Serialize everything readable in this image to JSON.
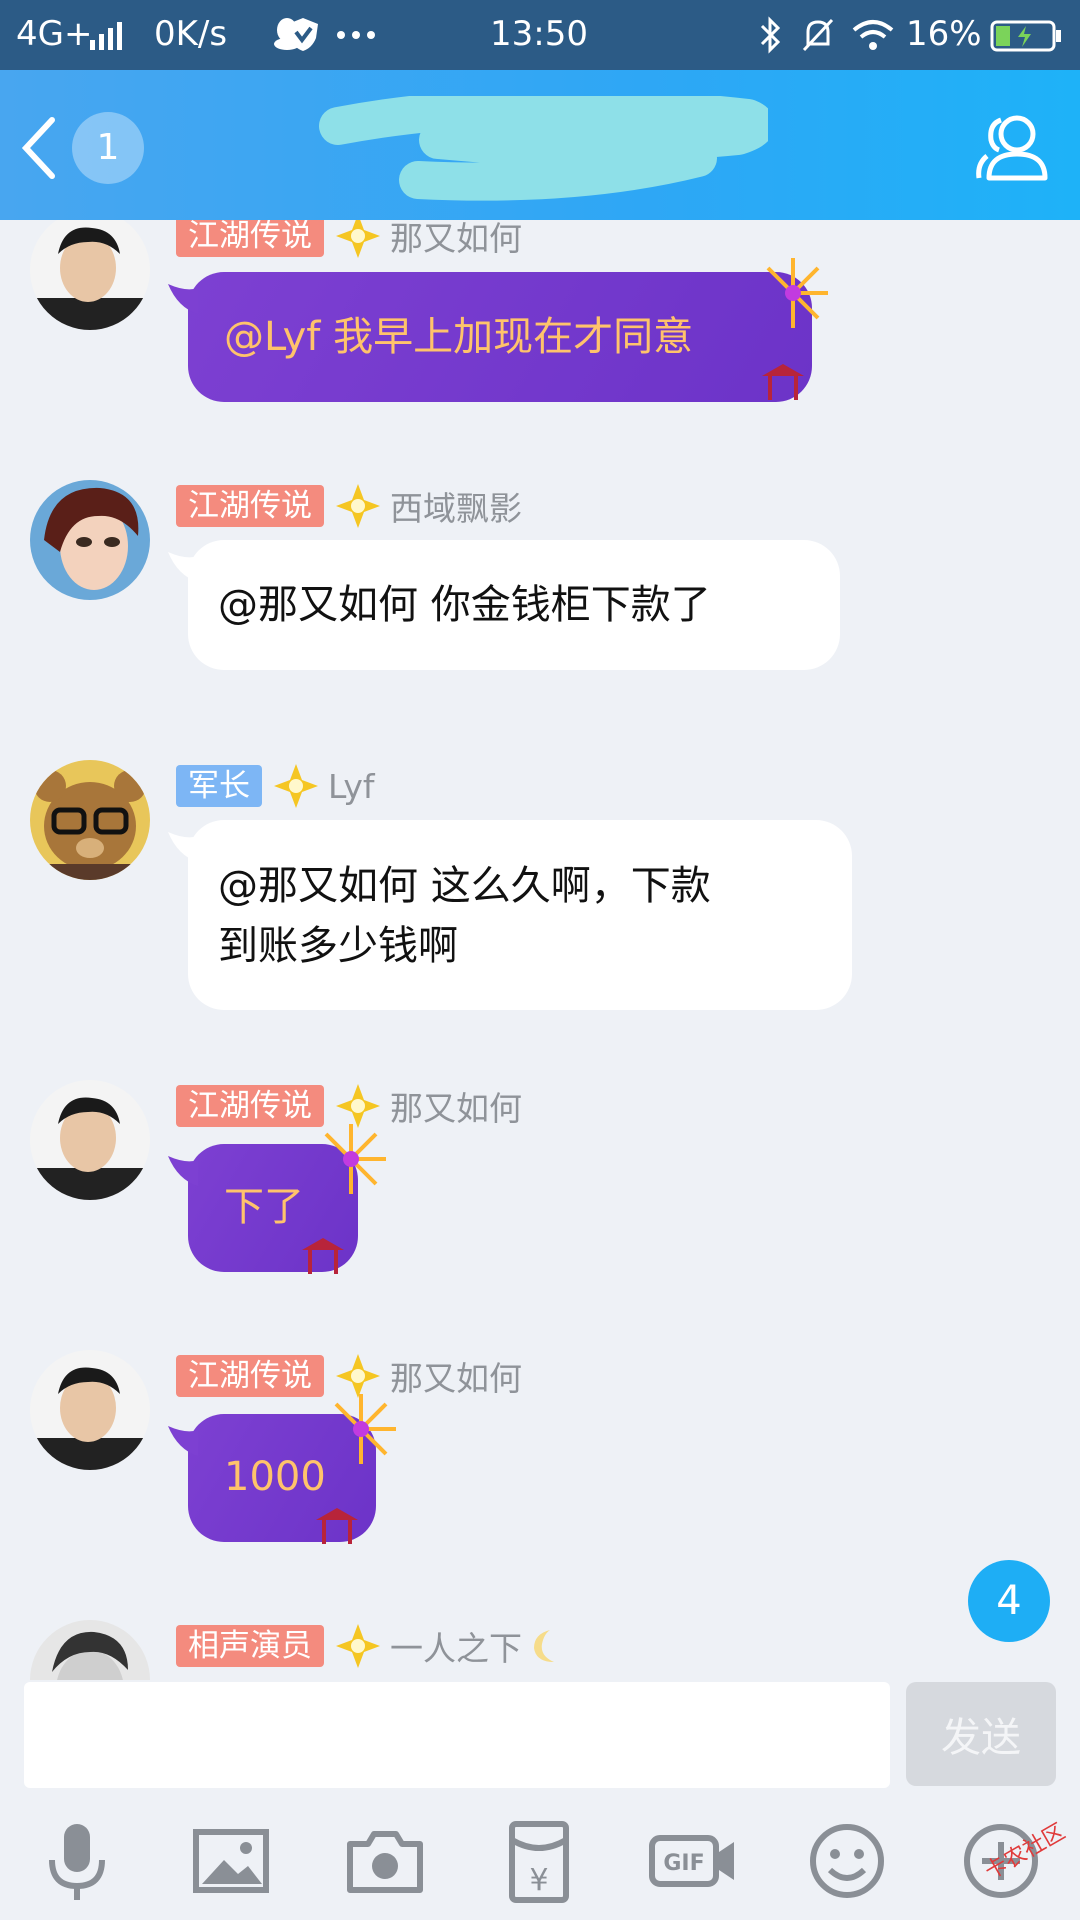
{
  "status_bar": {
    "network": "4G+",
    "speed": "0K/s",
    "time": "13:50",
    "battery": "16%",
    "icons": [
      "signal-icon",
      "qq-icon",
      "shield-icon",
      "more-dots-icon",
      "bluetooth-icon",
      "mute-icon",
      "wifi-icon",
      "battery-icon"
    ]
  },
  "header": {
    "unread_count": "1",
    "title": ""
  },
  "messages": [
    {
      "tag": "江湖传说",
      "tag_color": "#f48b7e",
      "nickname": "那又如何",
      "text": "@Lyf 我早上加现在才同意",
      "style": "purple"
    },
    {
      "tag": "江湖传说",
      "tag_color": "#f48b7e",
      "nickname": "西域飘影",
      "text": "@那又如何 你金钱柜下款了",
      "style": "white"
    },
    {
      "tag": "军长",
      "tag_color": "#7db6f5",
      "nickname": "Lyf",
      "text_lines": [
        "@那又如何 这么久啊，下款",
        "到账多少钱啊"
      ],
      "style": "white"
    },
    {
      "tag": "江湖传说",
      "tag_color": "#f48b7e",
      "nickname": "那又如何",
      "text": "下了",
      "style": "purple"
    },
    {
      "tag": "江湖传说",
      "tag_color": "#f48b7e",
      "nickname": "那又如何",
      "text": "1000",
      "style": "purple"
    },
    {
      "tag": "相声演员",
      "tag_color": "#f48b7e",
      "nickname": "一人之下",
      "text": "",
      "style": "partial"
    }
  ],
  "new_message_badge": "4",
  "input": {
    "value": "",
    "placeholder": "",
    "send_label": "发送"
  },
  "toolbar": {
    "items": [
      "microphone-icon",
      "image-icon",
      "camera-icon",
      "red-packet-icon",
      "gif-icon",
      "emoji-icon",
      "plus-icon"
    ],
    "gif_label": "GIF",
    "yen_symbol": "¥"
  },
  "watermark": "卡农社区"
}
